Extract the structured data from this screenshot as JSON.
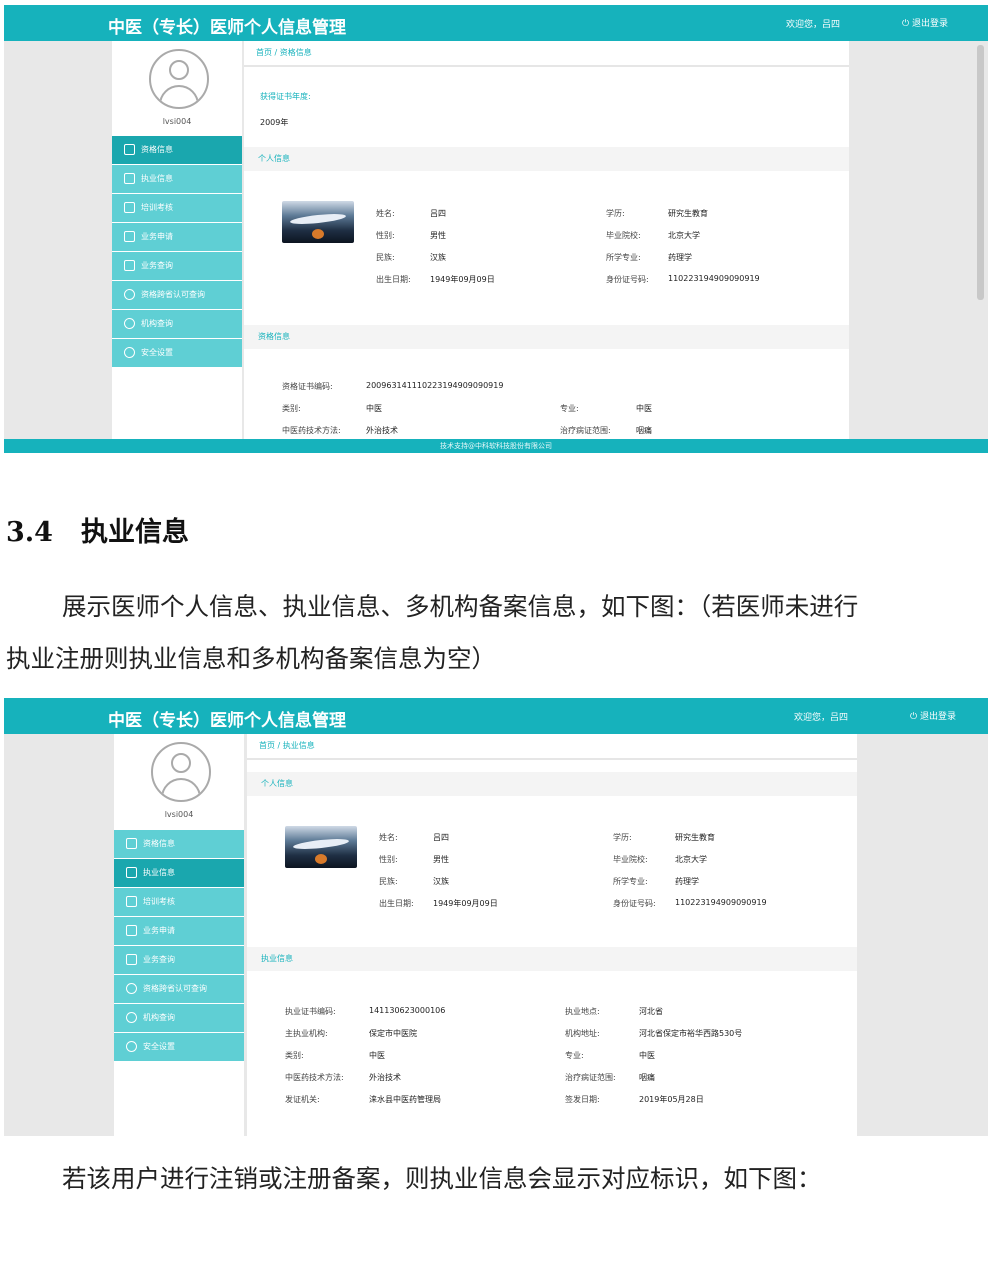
{
  "app": {
    "title": "中医（专长）医师个人信息管理",
    "welcome": "欢迎您，吕四",
    "logout": "退出登录",
    "username": "lvsi004",
    "footer": "技术支持@中科软科技股份有限公司",
    "menu": [
      "资格信息",
      "执业信息",
      "培训考核",
      "业务申请",
      "业务查询",
      "资格跨省认可查询",
      "机构查询",
      "安全设置"
    ]
  },
  "shot1": {
    "crumb": "首页 / 资格信息",
    "cert_year_label": "获得证书年度:",
    "cert_year_value": "2009年",
    "personal_title": "个人信息",
    "qual_title": "资格信息",
    "personal": [
      {
        "label": "姓名:",
        "value": "吕四"
      },
      {
        "label": "性别:",
        "value": "男性"
      },
      {
        "label": "民族:",
        "value": "汉族"
      },
      {
        "label": "出生日期:",
        "value": "1949年09月09日"
      },
      {
        "label": "学历:",
        "value": "研究生教育"
      },
      {
        "label": "毕业院校:",
        "value": "北京大学"
      },
      {
        "label": "所学专业:",
        "value": "药理学"
      },
      {
        "label": "身份证号码:",
        "value": "110223194909090919"
      }
    ],
    "qual": [
      {
        "label": "资格证书编码:",
        "value": "20096314111022319490909091​9"
      },
      {
        "label": "类别:",
        "value": "中医"
      },
      {
        "label": "中医药技术方法:",
        "value": "外治技术"
      },
      {
        "label": "专业:",
        "value": "中医"
      },
      {
        "label": "治疗病证范围:",
        "value": "咽痛"
      }
    ]
  },
  "doc": {
    "section_num": "3.4",
    "section_title": "执业信息",
    "para1_line1": "展示医师个人信息、执业信息、多机构备案信息，如下图：（若医师未进行",
    "para1_line2": "执业注册则执业信息和多机构备案信息为空）",
    "para2": "若该用户进行注销或注册备案，则执业信息会显示对应标识，如下图："
  },
  "shot2": {
    "crumb": "首页 / 执业信息",
    "personal_title": "个人信息",
    "practice_title": "执业信息",
    "personal": [
      {
        "label": "姓名:",
        "value": "吕四"
      },
      {
        "label": "性别:",
        "value": "男性"
      },
      {
        "label": "民族:",
        "value": "汉族"
      },
      {
        "label": "出生日期:",
        "value": "1949年09月09日"
      },
      {
        "label": "学历:",
        "value": "研究生教育"
      },
      {
        "label": "毕业院校:",
        "value": "北京大学"
      },
      {
        "label": "所学专业:",
        "value": "药理学"
      },
      {
        "label": "身份证号码:",
        "value": "110223194909090919"
      }
    ],
    "practice": [
      {
        "label": "执业证书编码:",
        "value": "141130623000106"
      },
      {
        "label": "主执业机构:",
        "value": "保定市中医院"
      },
      {
        "label": "类别:",
        "value": "中医"
      },
      {
        "label": "中医药技术方法:",
        "value": "外治技术"
      },
      {
        "label": "发证机关:",
        "value": "涞水县中医药管理局"
      },
      {
        "label": "执业地点:",
        "value": "河北省"
      },
      {
        "label": "机构地址:",
        "value": "河北省保定市裕华西路530号"
      },
      {
        "label": "专业:",
        "value": "中医"
      },
      {
        "label": "治疗病证范围:",
        "value": "咽痛"
      },
      {
        "label": "签发日期:",
        "value": "2019年05月28日"
      }
    ]
  }
}
